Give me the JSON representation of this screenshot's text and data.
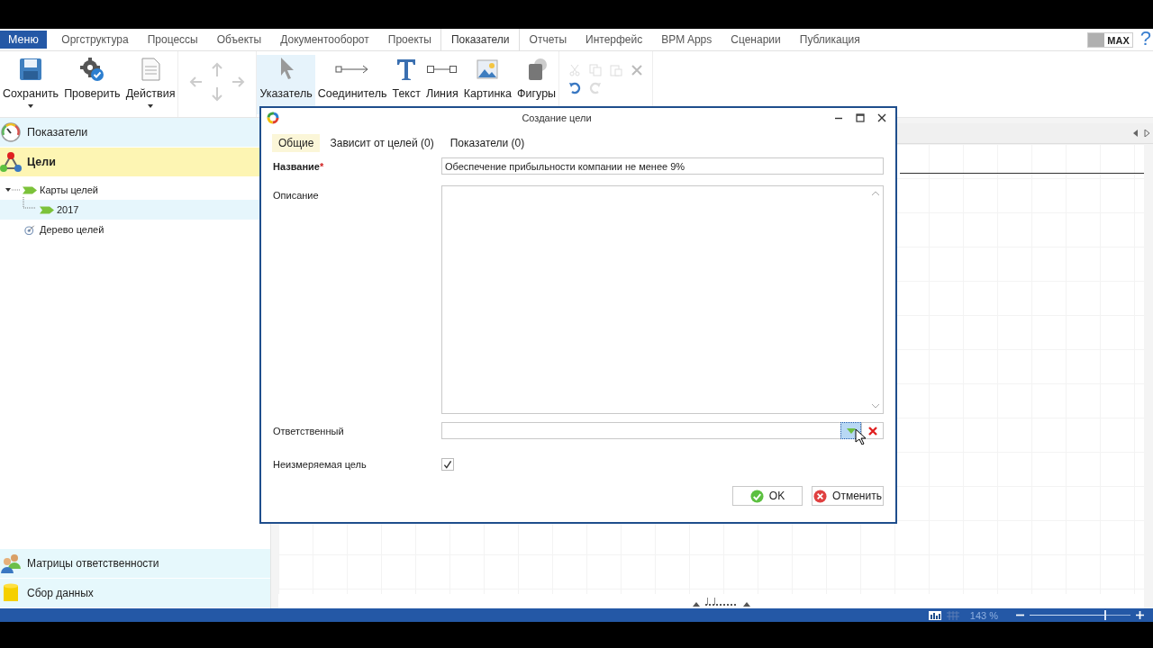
{
  "menu_button": "Меню",
  "menu_tabs": [
    {
      "label": "Оргструктура",
      "selected": false
    },
    {
      "label": "Процессы",
      "selected": false
    },
    {
      "label": "Объекты",
      "selected": false
    },
    {
      "label": "Документооборот",
      "selected": false
    },
    {
      "label": "Проекты",
      "selected": false
    },
    {
      "label": "Показатели",
      "selected": true
    },
    {
      "label": "Отчеты",
      "selected": false
    },
    {
      "label": "Интерфейс",
      "selected": false
    },
    {
      "label": "BPM Apps",
      "selected": false
    },
    {
      "label": "Сценарии",
      "selected": false
    },
    {
      "label": "Публикация",
      "selected": false
    }
  ],
  "max_badge": "MAX",
  "help": "?",
  "toolbar_main": [
    {
      "kind": "save",
      "label": "Сохранить",
      "dropdown": true
    },
    {
      "kind": "check",
      "label": "Проверить",
      "dropdown": false
    },
    {
      "kind": "actions",
      "label": "Действия",
      "dropdown": true
    }
  ],
  "toolbar_tools": [
    {
      "kind": "pointer",
      "label": "Указатель",
      "selected": true
    },
    {
      "kind": "connector",
      "label": "Соединитель",
      "selected": false
    },
    {
      "kind": "text",
      "label": "Текст",
      "selected": false
    },
    {
      "kind": "line",
      "label": "Линия",
      "selected": false
    },
    {
      "kind": "picture",
      "label": "Картинка",
      "selected": false
    },
    {
      "kind": "shapes",
      "label": "Фигуры",
      "selected": false
    }
  ],
  "sidebar": {
    "sections": [
      {
        "kind": "gauge",
        "label": "Показатели",
        "selected": false
      },
      {
        "kind": "goals",
        "label": "Цели",
        "selected": true
      }
    ],
    "tree": [
      {
        "kind": "map",
        "label": "Карты целей",
        "expanded": true,
        "selected": false,
        "children": [
          {
            "kind": "map",
            "label": "2017",
            "selected": true
          }
        ]
      },
      {
        "kind": "target",
        "label": "Дерево целей",
        "selected": false
      }
    ],
    "bottom": [
      {
        "kind": "people",
        "label": "Матрицы ответственности"
      },
      {
        "kind": "data",
        "label": "Сбор данных"
      }
    ]
  },
  "dialog": {
    "title": "Создание цели",
    "tabs": [
      {
        "label": "Общие",
        "selected": true
      },
      {
        "label": "Зависит от целей (0)",
        "selected": false
      },
      {
        "label": "Показатели (0)",
        "selected": false
      }
    ],
    "name": {
      "label": "Название",
      "required": true,
      "required_mark": "*",
      "value": "Обеспечение прибыльности компании не менее 9%"
    },
    "description": {
      "label": "Описание"
    },
    "responsible": {
      "label": "Ответственный"
    },
    "unmeasurable": {
      "label": "Неизмеряемая цель",
      "checked": true
    },
    "buttons": [
      {
        "kind": "ok",
        "label": "OK"
      },
      {
        "kind": "cancel",
        "label": "Отменить"
      }
    ]
  },
  "status_bar": {
    "zoom": "143 %",
    "level": 0.75
  }
}
